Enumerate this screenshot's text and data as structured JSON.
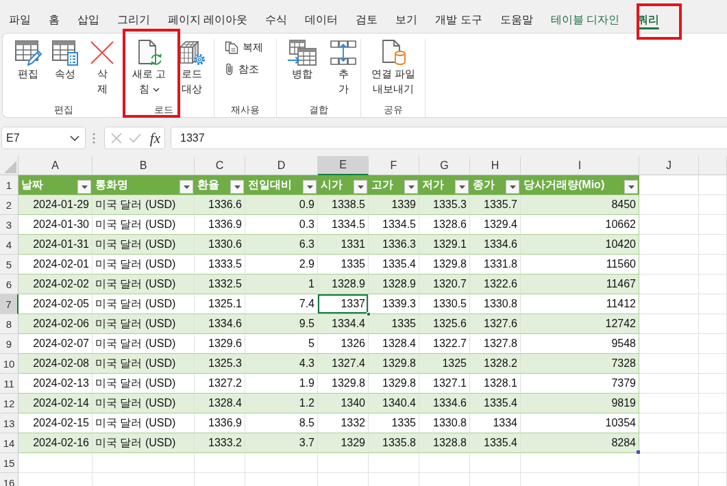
{
  "ribbon_tabs": [
    {
      "label": "파일",
      "selected": false,
      "contextual": false,
      "highlighted": false
    },
    {
      "label": "홈",
      "selected": false,
      "contextual": false,
      "highlighted": false
    },
    {
      "label": "삽입",
      "selected": false,
      "contextual": false,
      "highlighted": false
    },
    {
      "label": "그리기",
      "selected": false,
      "contextual": false,
      "highlighted": false
    },
    {
      "label": "페이지 레이아웃",
      "selected": false,
      "contextual": false,
      "highlighted": false
    },
    {
      "label": "수식",
      "selected": false,
      "contextual": false,
      "highlighted": false
    },
    {
      "label": "데이터",
      "selected": false,
      "contextual": false,
      "highlighted": false
    },
    {
      "label": "검토",
      "selected": false,
      "contextual": false,
      "highlighted": false
    },
    {
      "label": "보기",
      "selected": false,
      "contextual": false,
      "highlighted": false
    },
    {
      "label": "개발 도구",
      "selected": false,
      "contextual": false,
      "highlighted": false
    },
    {
      "label": "도움말",
      "selected": false,
      "contextual": false,
      "highlighted": false
    },
    {
      "label": "테이블 디자인",
      "selected": false,
      "contextual": true,
      "highlighted": false
    },
    {
      "label": "쿼리",
      "selected": true,
      "contextual": true,
      "highlighted": true
    }
  ],
  "ribbon_groups": [
    {
      "label": "편집",
      "buttons": [
        {
          "kind": "large",
          "lines": [
            "편집"
          ],
          "dropdown": false,
          "highlighted": false
        },
        {
          "kind": "large",
          "lines": [
            "속성"
          ],
          "dropdown": false,
          "highlighted": false
        },
        {
          "kind": "large",
          "lines": [
            "삭",
            "제"
          ],
          "dropdown": false,
          "highlighted": false
        }
      ]
    },
    {
      "label": "로드",
      "buttons": [
        {
          "kind": "large",
          "lines": [
            "새로 고",
            "침"
          ],
          "dropdown": true,
          "highlighted": true
        },
        {
          "kind": "large",
          "lines": [
            "로드",
            "대상"
          ],
          "dropdown": false,
          "highlighted": false
        }
      ]
    },
    {
      "label": "재사용",
      "buttons": [
        {
          "kind": "small",
          "lines": [
            "복제"
          ],
          "dropdown": false,
          "highlighted": false
        },
        {
          "kind": "small",
          "lines": [
            "참조"
          ],
          "dropdown": false,
          "highlighted": false
        }
      ]
    },
    {
      "label": "결합",
      "buttons": [
        {
          "kind": "large",
          "lines": [
            "병합"
          ],
          "dropdown": false,
          "highlighted": false
        },
        {
          "kind": "large",
          "lines": [
            "추",
            "가"
          ],
          "dropdown": false,
          "highlighted": false
        }
      ]
    },
    {
      "label": "공유",
      "buttons": [
        {
          "kind": "large",
          "lines": [
            "연결 파일",
            "내보내기"
          ],
          "dropdown": false,
          "highlighted": false
        }
      ]
    }
  ],
  "formula_bar": {
    "name_box": "E7",
    "function_button": "fx",
    "formula": "1337"
  },
  "sheet": {
    "columns": [
      {
        "label": "A",
        "selected": false
      },
      {
        "label": "B",
        "selected": false
      },
      {
        "label": "C",
        "selected": false
      },
      {
        "label": "D",
        "selected": false
      },
      {
        "label": "E",
        "selected": true
      },
      {
        "label": "F",
        "selected": false
      },
      {
        "label": "G",
        "selected": false
      },
      {
        "label": "H",
        "selected": false
      },
      {
        "label": "I",
        "selected": false
      },
      {
        "label": "J",
        "selected": false
      }
    ],
    "rows": [
      {
        "number": "1",
        "selected": false,
        "kind": "table-header",
        "cells": [
          "날짜",
          "통화명",
          "환율",
          "전일대비",
          "시가",
          "고가",
          "저가",
          "종가",
          "당사거래량(Mio)"
        ]
      },
      {
        "number": "2",
        "selected": false,
        "kind": "table-row",
        "cells": [
          "2024-01-29",
          "미국 달러 (USD)",
          "1336.6",
          "0.9",
          "1338.5",
          "1339",
          "1335.3",
          "1335.7",
          "8450"
        ]
      },
      {
        "number": "3",
        "selected": false,
        "kind": "table-row",
        "cells": [
          "2024-01-30",
          "미국 달러 (USD)",
          "1336.9",
          "0.3",
          "1334.5",
          "1334.5",
          "1328.6",
          "1329.4",
          "10662"
        ]
      },
      {
        "number": "4",
        "selected": false,
        "kind": "table-row",
        "cells": [
          "2024-01-31",
          "미국 달러 (USD)",
          "1330.6",
          "6.3",
          "1331",
          "1336.3",
          "1329.1",
          "1334.6",
          "10420"
        ]
      },
      {
        "number": "5",
        "selected": false,
        "kind": "table-row",
        "cells": [
          "2024-02-01",
          "미국 달러 (USD)",
          "1333.5",
          "2.9",
          "1335",
          "1335.4",
          "1329.8",
          "1331.8",
          "11560"
        ]
      },
      {
        "number": "6",
        "selected": false,
        "kind": "table-row",
        "cells": [
          "2024-02-02",
          "미국 달러 (USD)",
          "1332.5",
          "1",
          "1328.9",
          "1328.9",
          "1320.7",
          "1322.6",
          "11467"
        ]
      },
      {
        "number": "7",
        "selected": true,
        "kind": "table-row",
        "cells": [
          "2024-02-05",
          "미국 달러 (USD)",
          "1325.1",
          "7.4",
          "1337",
          "1339.3",
          "1330.5",
          "1330.8",
          "11412"
        ]
      },
      {
        "number": "8",
        "selected": false,
        "kind": "table-row",
        "cells": [
          "2024-02-06",
          "미국 달러 (USD)",
          "1334.6",
          "9.5",
          "1334.4",
          "1335",
          "1325.6",
          "1327.6",
          "12742"
        ]
      },
      {
        "number": "9",
        "selected": false,
        "kind": "table-row",
        "cells": [
          "2024-02-07",
          "미국 달러 (USD)",
          "1329.6",
          "5",
          "1326",
          "1328.4",
          "1322.7",
          "1327.8",
          "9548"
        ]
      },
      {
        "number": "10",
        "selected": false,
        "kind": "table-row",
        "cells": [
          "2024-02-08",
          "미국 달러 (USD)",
          "1325.3",
          "4.3",
          "1327.4",
          "1329.8",
          "1325",
          "1328.2",
          "7328"
        ]
      },
      {
        "number": "11",
        "selected": false,
        "kind": "table-row",
        "cells": [
          "2024-02-13",
          "미국 달러 (USD)",
          "1327.2",
          "1.9",
          "1329.8",
          "1329.8",
          "1327.1",
          "1328.1",
          "7379"
        ]
      },
      {
        "number": "12",
        "selected": false,
        "kind": "table-row",
        "cells": [
          "2024-02-14",
          "미국 달러 (USD)",
          "1328.4",
          "1.2",
          "1340",
          "1340.4",
          "1334.6",
          "1335.4",
          "9819"
        ]
      },
      {
        "number": "13",
        "selected": false,
        "kind": "table-row",
        "cells": [
          "2024-02-15",
          "미국 달러 (USD)",
          "1336.9",
          "8.5",
          "1332",
          "1335",
          "1330.8",
          "1334",
          "10354"
        ]
      },
      {
        "number": "14",
        "selected": false,
        "kind": "table-row",
        "cells": [
          "2024-02-16",
          "미국 달러 (USD)",
          "1333.2",
          "3.7",
          "1329",
          "1335.8",
          "1328.8",
          "1335.4",
          "8284"
        ]
      },
      {
        "number": "15",
        "selected": false,
        "kind": "empty"
      },
      {
        "number": "16",
        "selected": false,
        "kind": "empty"
      }
    ]
  }
}
